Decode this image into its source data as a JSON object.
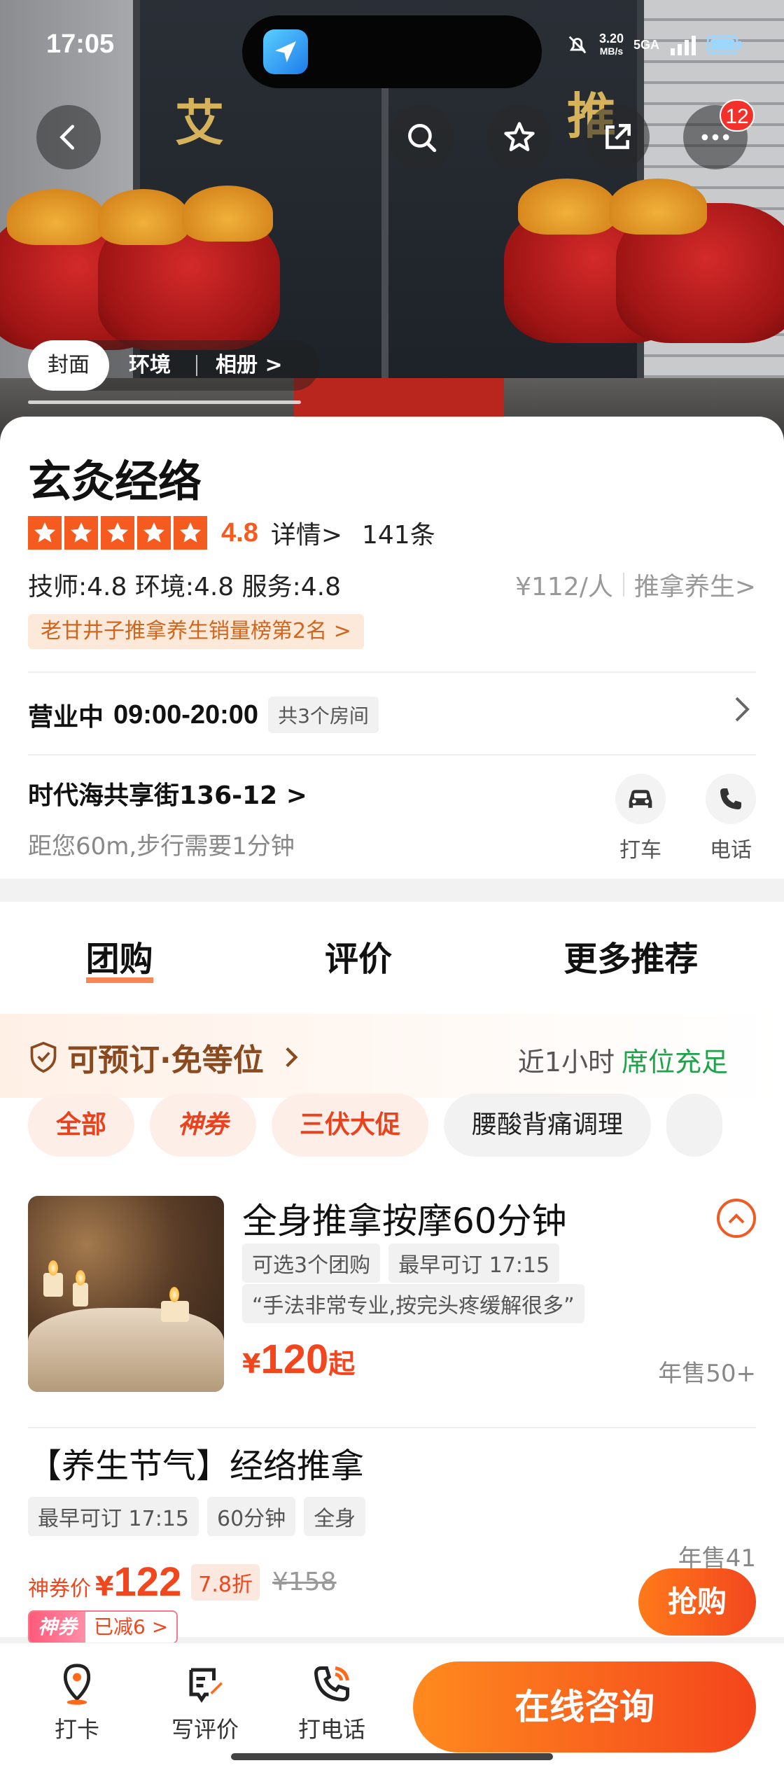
{
  "status_bar": {
    "time": "17:05",
    "net_speed": "3.20",
    "net_unit": "MB/s",
    "network": "5GA"
  },
  "header": {
    "more_badge": "12"
  },
  "photo_tabs": [
    "封面",
    "环境",
    "相册 >"
  ],
  "shop": {
    "name": "玄灸经络",
    "rating": "4.8",
    "rating_link": "详情>",
    "review_count": "141条",
    "sub_scores": "技师:4.8  环境:4.8  服务:4.8",
    "price_per_person": "¥112/人",
    "category": "推拿养生>",
    "rank_badge": "老甘井子推拿养生销量榜第2名  >",
    "status": "营业中",
    "hours": "09:00-20:00",
    "rooms": "共3个房间",
    "address": "时代海共享街136-12 >",
    "distance": "距您60m,步行需要1分钟",
    "taxi_label": "打车",
    "phone_label": "电话"
  },
  "tabs": [
    "团购",
    "评价",
    "更多推荐"
  ],
  "booking": {
    "label": "可预订·免等位",
    "recent": "近1小时",
    "availability": "席位充足",
    "availability_color": "#1fa34a"
  },
  "chips": [
    "全部",
    "神券",
    "三伏大促",
    "腰酸背痛调理"
  ],
  "deals": [
    {
      "title": "全身推拿按摩60分钟",
      "tags": [
        "可选3个团购",
        "最早可订 17:15"
      ],
      "quote": "“手法非常专业,按完头疼缓解很多”",
      "currency": "¥",
      "price": "120",
      "price_suffix": "起",
      "sold": "年售50+"
    },
    {
      "title": "【养生节气】经络推拿",
      "tags": [
        "最早可订 17:15",
        "60分钟",
        "全身"
      ],
      "price_label": "神券价",
      "currency": "¥",
      "price": "122",
      "discount": "7.8折",
      "original_price": "¥158",
      "coupon_tag": "神券",
      "coupon_value": "已减6 >",
      "sold": "年售41",
      "buy_label": "抢购"
    }
  ],
  "bottom_bar": {
    "checkin": "打卡",
    "review": "写评价",
    "call": "打电话",
    "consult": "在线咨询"
  },
  "colors": {
    "accent": "#f55a1f",
    "price": "#f2461e",
    "brand_gradient_start": "#ff8a1e",
    "brand_gradient_end": "#f4451c"
  }
}
